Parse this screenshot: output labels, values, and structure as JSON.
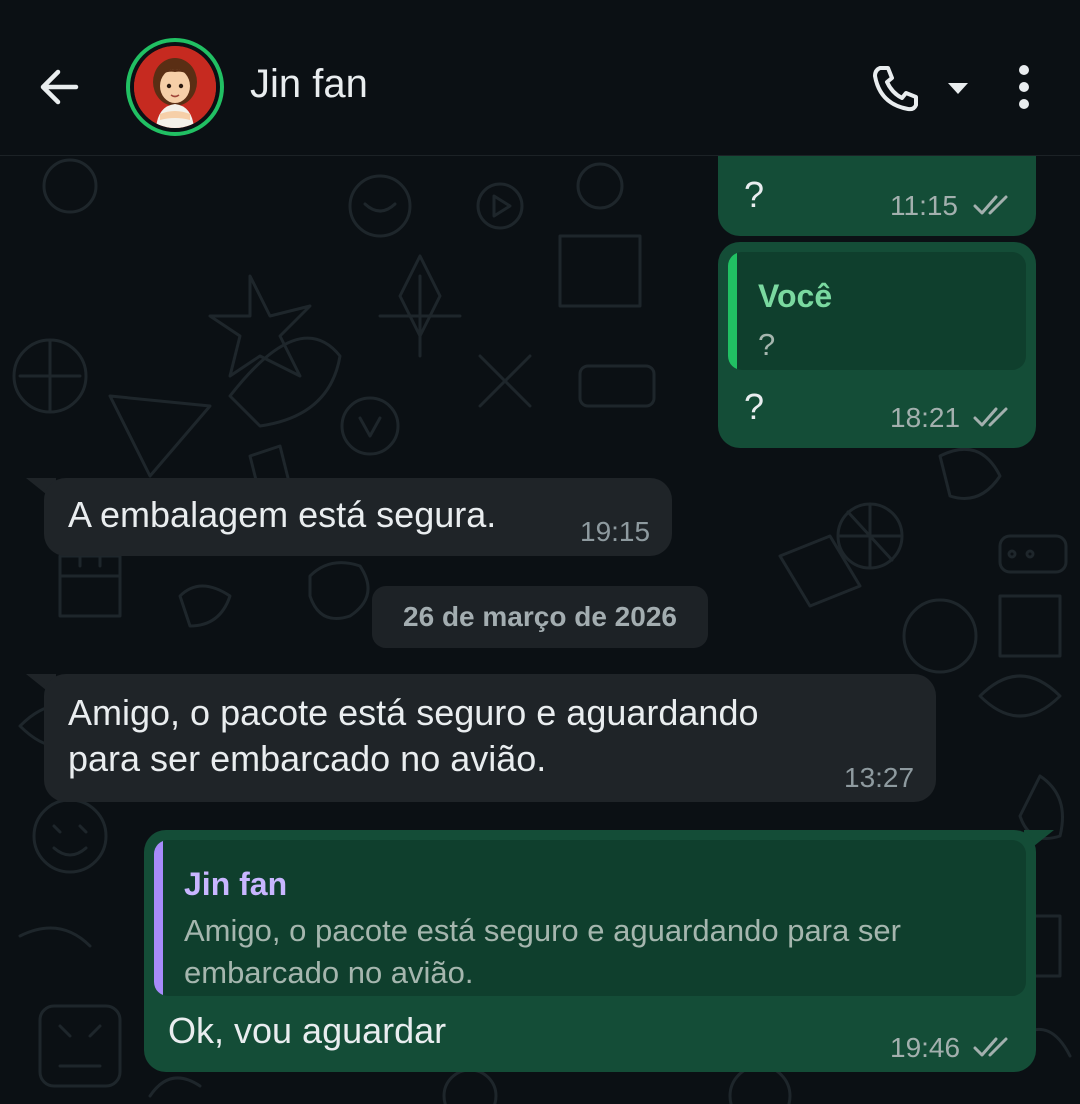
{
  "header": {
    "contact_name": "Jin fan",
    "icons": [
      "back-arrow-icon",
      "phone-icon",
      "dropdown-arrow-icon",
      "more-vertical-icon"
    ]
  },
  "messages": [
    {
      "direction": "out",
      "text": "?",
      "time": "11:15",
      "status": "read"
    },
    {
      "direction": "out",
      "quote_author": "Você",
      "quote_text": "?",
      "text": "?",
      "time": "18:21",
      "status": "read"
    },
    {
      "direction": "in",
      "text": "A embalagem está segura.",
      "time": "19:15"
    },
    {
      "direction": "in",
      "text": "Amigo, o pacote está seguro e aguardando\npara ser embarcado no avião.",
      "time": "13:27"
    },
    {
      "direction": "out",
      "quote_author": "Jin fan",
      "quote_text": "Amigo, o pacote está seguro e aguardando para ser\nembarcado no avião.",
      "text": "Ok, vou aguardar",
      "time": "19:46",
      "status": "read"
    }
  ],
  "date_separator": "26 de março de 2026",
  "colors": {
    "outgoing_bubble": "#144d37",
    "incoming_bubble": "#1f2428",
    "quote_self_bar": "#21c063",
    "quote_self_author": "#7ad9a0",
    "quote_contact_bar": "#a78bfa",
    "quote_contact_author": "#c8b6ff",
    "avatar_ring": "#21c063"
  }
}
